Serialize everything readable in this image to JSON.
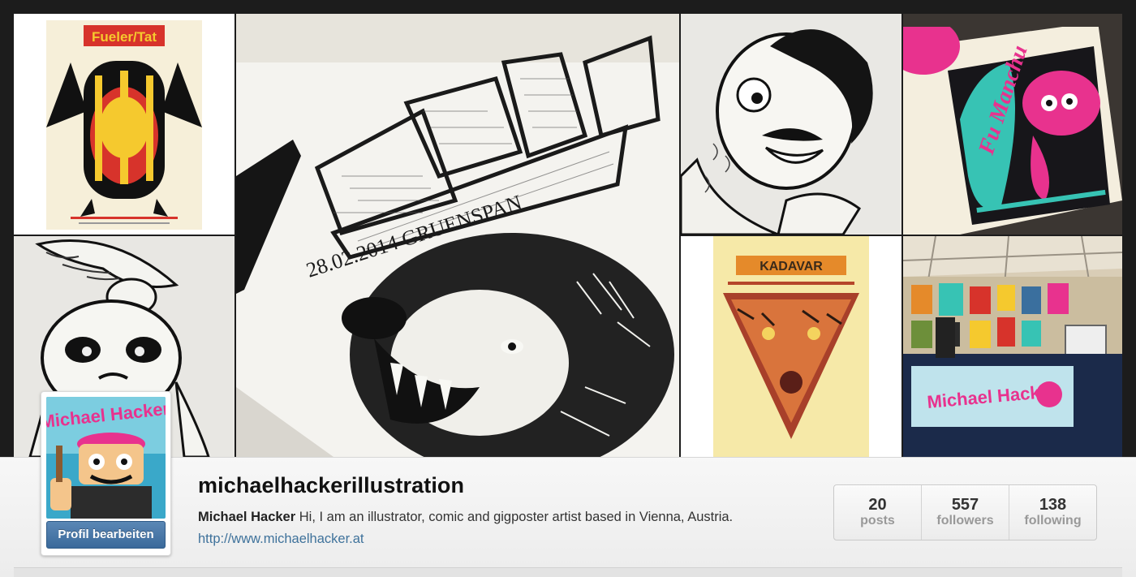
{
  "profile": {
    "username": "michaelhackerillustration",
    "full_name": "Michael Hacker",
    "bio": "Hi, I am an illustrator, comic and gigposter artist based in Vienna, Austria.",
    "website": "http://www.michaelhacker.at",
    "edit_button_label": "Profil bearbeiten"
  },
  "stats": [
    {
      "value": "20",
      "label": "posts"
    },
    {
      "value": "557",
      "label": "followers"
    },
    {
      "value": "138",
      "label": "following"
    }
  ],
  "mosaic": {
    "tiles": [
      {
        "name": "photo-poster-fueler-icon",
        "poster_text": "Fueler/Tat"
      },
      {
        "name": "photo-bear-drawing",
        "poster_text": "28.02.2014 GRUENSPAN"
      },
      {
        "name": "photo-boy-sketch"
      },
      {
        "name": "photo-fu-manchu-print",
        "poster_text": "Fu Manchu"
      },
      {
        "name": "photo-grumpy-cat-sketch"
      },
      {
        "name": "photo-kadavar-poster",
        "poster_text": "KADAVAR"
      },
      {
        "name": "photo-market-stall",
        "poster_text": "Michael Hacker"
      }
    ]
  },
  "colors": {
    "background": "#1c1c1c",
    "button_blue": "#3b6a9b",
    "link_blue": "#3f729b",
    "poster_red": "#d7332b",
    "poster_yellow": "#f5c92e",
    "print_pink": "#e8328e",
    "print_teal": "#37c3b4"
  }
}
